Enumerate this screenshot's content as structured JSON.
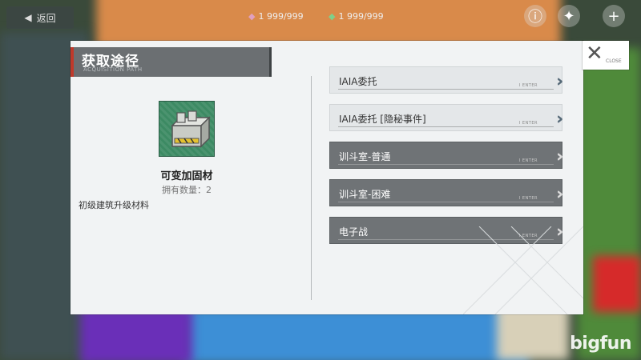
{
  "background": {
    "back_label": "返回",
    "resource_1": "1 999/999",
    "resource_2": "1 999/999",
    "watermark": "bigfun"
  },
  "dialog": {
    "title": "获取途径",
    "title_en": "ACQUISITION PATH",
    "close_label": "CLOSE",
    "item": {
      "name": "可变加固材",
      "owned": "拥有数量：2",
      "description": "初级建筑升级材料"
    },
    "routes": [
      {
        "label": "IAIA委托",
        "enter": "I ENTER",
        "style": "light"
      },
      {
        "label": "IAIA委托 [隐秘事件]",
        "enter": "I ENTER",
        "style": "light"
      },
      {
        "label": "训斗室-普通",
        "enter": "I ENTER",
        "style": "dark"
      },
      {
        "label": "训斗室-困难",
        "enter": "I ENTER",
        "style": "dark"
      },
      {
        "label": "电子战",
        "enter": "I ENTER",
        "style": "dark"
      }
    ]
  },
  "colors": {
    "accent_red": "#c0392b",
    "title_bg": "#6b6f72",
    "dark_route": "#6f7376",
    "light_route": "#e4e7e9"
  }
}
